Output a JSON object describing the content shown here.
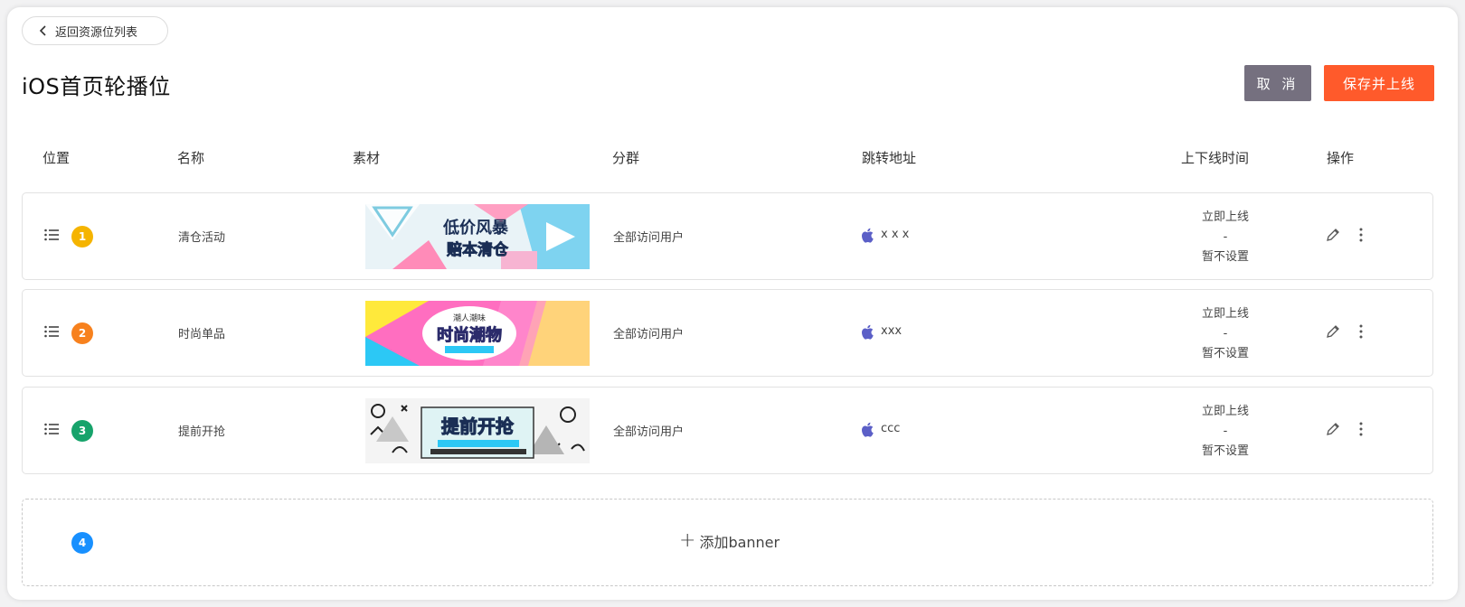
{
  "back_button": {
    "label": "返回资源位列表"
  },
  "page_title": "iOS首页轮播位",
  "actions": {
    "cancel": "取 消",
    "save": "保存并上线"
  },
  "columns": {
    "position": "位置",
    "name": "名称",
    "material": "素材",
    "group": "分群",
    "url": "跳转地址",
    "time": "上下线时间",
    "ops": "操作"
  },
  "rows": [
    {
      "index": "1",
      "badge_color": "#f5b400",
      "name": "清仓活动",
      "group": "全部访问用户",
      "url": "x x x",
      "time_on": "立即上线",
      "time_sep": "-",
      "time_off": "暂不设置",
      "banner": {
        "line1": "低价风暴",
        "line2": "赔本清仓"
      }
    },
    {
      "index": "2",
      "badge_color": "#f7811e",
      "name": "时尚单品",
      "group": "全部访问用户",
      "url": "xxx",
      "time_on": "立即上线",
      "time_sep": "-",
      "time_off": "暂不设置",
      "banner": {
        "line1": "潮人潮味",
        "line2": "时尚潮物"
      }
    },
    {
      "index": "3",
      "badge_color": "#17a36b",
      "name": "提前开抢",
      "group": "全部访问用户",
      "url": "ccc",
      "time_on": "立即上线",
      "time_sep": "-",
      "time_off": "暂不设置",
      "banner": {
        "line1": "提前开抢"
      }
    }
  ],
  "add_row": {
    "index": "4",
    "badge_color": "#1890ff",
    "label": "添加banner"
  },
  "icons": [
    "chevron-left-icon",
    "drag-handle-icon",
    "apple-icon",
    "pencil-icon",
    "more-vertical-icon",
    "plus-icon"
  ]
}
